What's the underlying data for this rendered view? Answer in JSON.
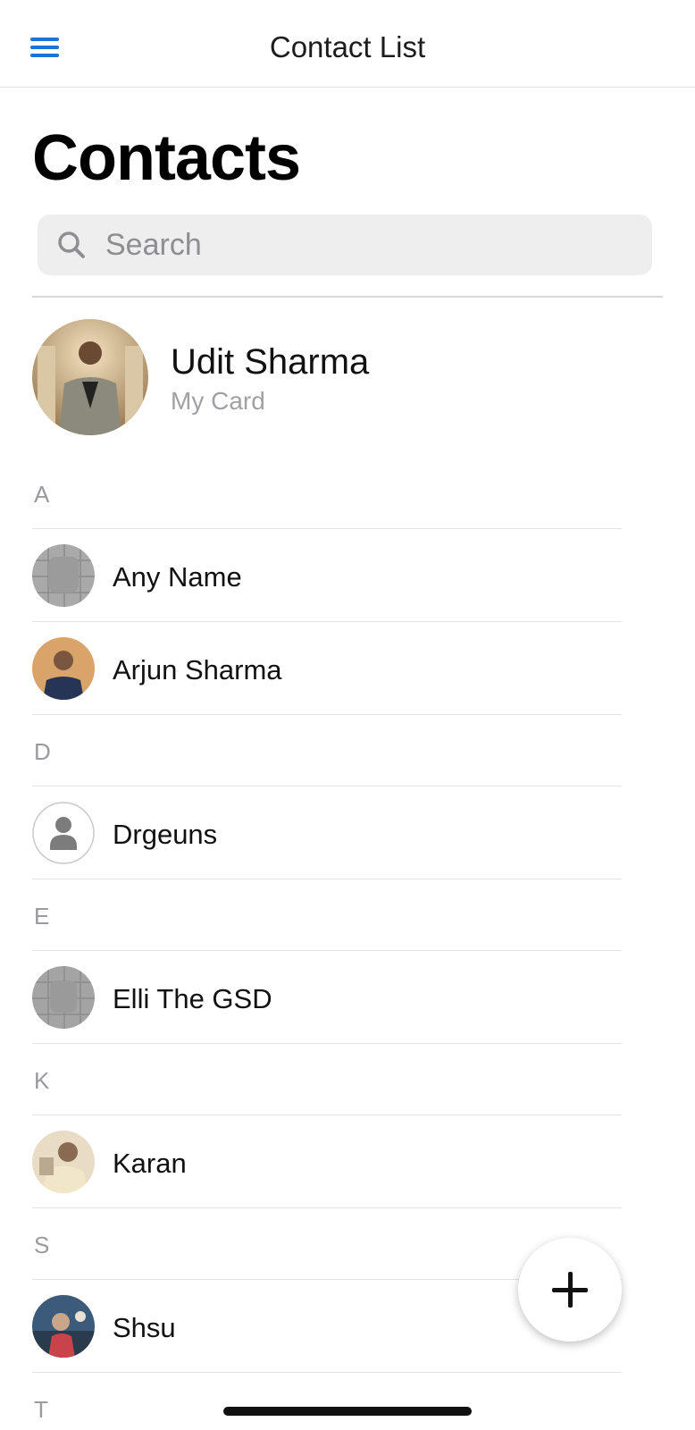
{
  "navbar": {
    "title": "Contact List",
    "menu_icon": "hamburger-menu-icon",
    "accent": "#1a73d9"
  },
  "page": {
    "title": "Contacts"
  },
  "search": {
    "placeholder": "Search",
    "value": "",
    "icon": "search-icon"
  },
  "my_card": {
    "name": "Udit Sharma",
    "subtitle": "My Card"
  },
  "sections": [
    {
      "letter": "A",
      "contacts": [
        {
          "name": "Any Name"
        },
        {
          "name": "Arjun Sharma"
        }
      ]
    },
    {
      "letter": "D",
      "contacts": [
        {
          "name": "Drgeuns"
        }
      ]
    },
    {
      "letter": "E",
      "contacts": [
        {
          "name": "Elli The GSD"
        }
      ]
    },
    {
      "letter": "K",
      "contacts": [
        {
          "name": "Karan"
        }
      ]
    },
    {
      "letter": "S",
      "contacts": [
        {
          "name": "Shsu"
        }
      ]
    },
    {
      "letter": "T",
      "contacts": []
    }
  ],
  "fab": {
    "icon": "plus-icon"
  }
}
